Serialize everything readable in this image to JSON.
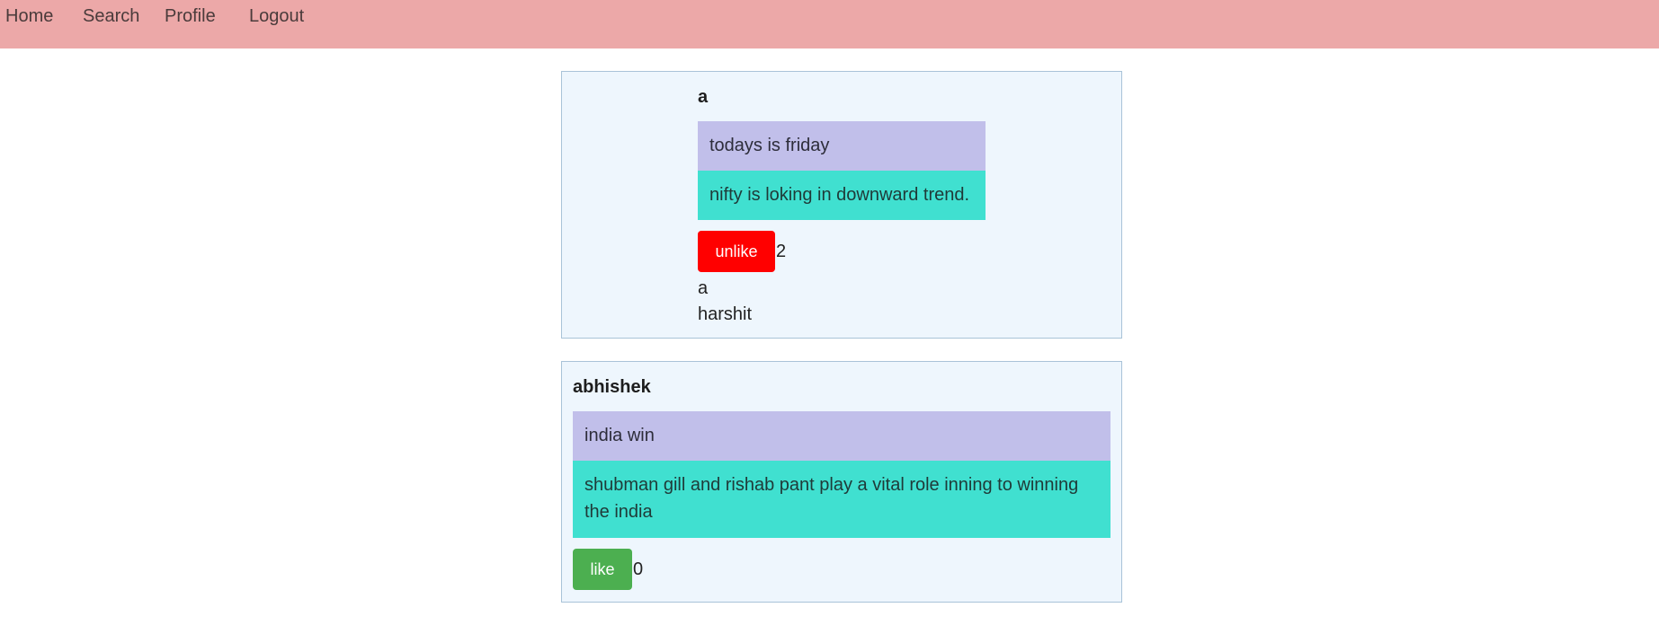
{
  "nav": {
    "home": "Home",
    "search": "Search",
    "profile": "Profile",
    "logout": "Logout"
  },
  "posts": [
    {
      "author": "a",
      "title": "todays is friday",
      "content": "nifty is loking in downward trend.",
      "button_label": "unlike",
      "like_count": "2",
      "likers": [
        "a",
        "harshit"
      ]
    },
    {
      "author": "abhishek",
      "title": "india win",
      "content": "shubman gill and rishab pant play a vital role inning to winning the india",
      "button_label": "like",
      "like_count": "0",
      "likers": []
    }
  ],
  "colors": {
    "navbar": "#eca8a8",
    "post_bg": "#eef6fd",
    "title_bg": "#c1bfea",
    "content_bg": "#40e0d0",
    "unlike_button": "#ff0000",
    "like_button": "#4caf50"
  }
}
